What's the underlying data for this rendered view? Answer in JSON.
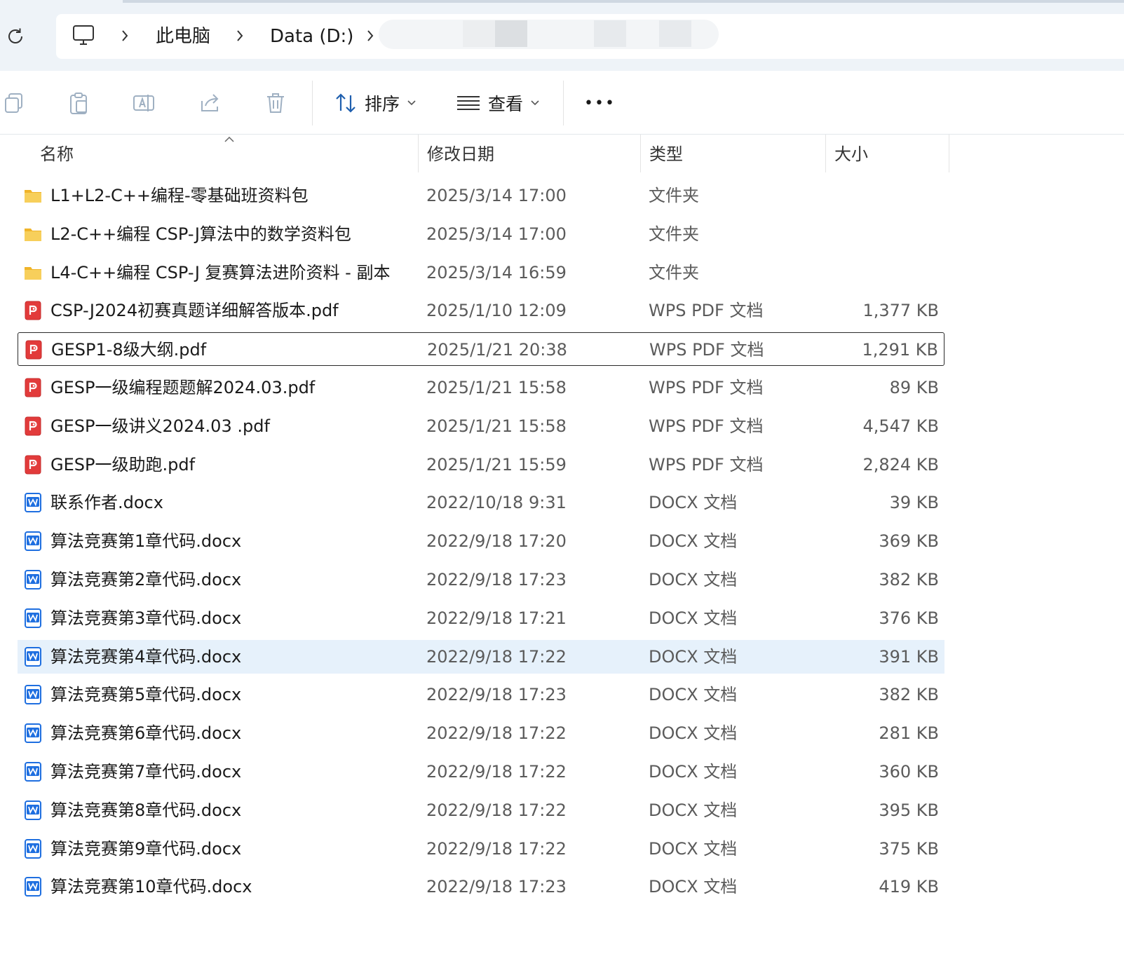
{
  "breadcrumb": {
    "items": [
      {
        "label": "此电脑"
      },
      {
        "label": "Data (D:)"
      }
    ]
  },
  "toolbar": {
    "sort_label": "排序",
    "view_label": "查看",
    "more_label": "•••"
  },
  "columns": {
    "name": "名称",
    "date": "修改日期",
    "type": "类型",
    "size": "大小"
  },
  "files": [
    {
      "icon": "folder-icon",
      "name": "L1+L2-C++编程-零基础班资料包",
      "date": "2025/3/14 17:00",
      "type": "文件夹",
      "size": ""
    },
    {
      "icon": "folder-icon",
      "name": "L2-C++编程 CSP-J算法中的数学资料包",
      "date": "2025/3/14 17:00",
      "type": "文件夹",
      "size": ""
    },
    {
      "icon": "folder-icon",
      "name": "L4-C++编程 CSP-J 复赛算法进阶资料 - 副本",
      "date": "2025/3/14 16:59",
      "type": "文件夹",
      "size": ""
    },
    {
      "icon": "pdf-icon",
      "name": "CSP-J2024初赛真题详细解答版本.pdf",
      "date": "2025/1/10 12:09",
      "type": "WPS PDF 文档",
      "size": "1,377 KB"
    },
    {
      "icon": "pdf-icon",
      "name": "GESP1-8级大纲.pdf",
      "date": "2025/1/21 20:38",
      "type": "WPS PDF 文档",
      "size": "1,291 KB",
      "state": "focused"
    },
    {
      "icon": "pdf-icon",
      "name": "GESP一级编程题题解2024.03.pdf",
      "date": "2025/1/21 15:58",
      "type": "WPS PDF 文档",
      "size": "89 KB"
    },
    {
      "icon": "pdf-icon",
      "name": "GESP一级讲义2024.03 .pdf",
      "date": "2025/1/21 15:58",
      "type": "WPS PDF 文档",
      "size": "4,547 KB"
    },
    {
      "icon": "pdf-icon",
      "name": "GESP一级助跑.pdf",
      "date": "2025/1/21 15:59",
      "type": "WPS PDF 文档",
      "size": "2,824 KB"
    },
    {
      "icon": "word-icon",
      "name": "联系作者.docx",
      "date": "2022/10/18 9:31",
      "type": "DOCX 文档",
      "size": "39 KB"
    },
    {
      "icon": "word-icon",
      "name": "算法竞赛第1章代码.docx",
      "date": "2022/9/18 17:20",
      "type": "DOCX 文档",
      "size": "369 KB"
    },
    {
      "icon": "word-icon",
      "name": "算法竞赛第2章代码.docx",
      "date": "2022/9/18 17:23",
      "type": "DOCX 文档",
      "size": "382 KB"
    },
    {
      "icon": "word-icon",
      "name": "算法竞赛第3章代码.docx",
      "date": "2022/9/18 17:21",
      "type": "DOCX 文档",
      "size": "376 KB"
    },
    {
      "icon": "word-icon",
      "name": "算法竞赛第4章代码.docx",
      "date": "2022/9/18 17:22",
      "type": "DOCX 文档",
      "size": "391 KB",
      "state": "hover"
    },
    {
      "icon": "word-icon",
      "name": "算法竞赛第5章代码.docx",
      "date": "2022/9/18 17:23",
      "type": "DOCX 文档",
      "size": "382 KB"
    },
    {
      "icon": "word-icon",
      "name": "算法竞赛第6章代码.docx",
      "date": "2022/9/18 17:22",
      "type": "DOCX 文档",
      "size": "281 KB"
    },
    {
      "icon": "word-icon",
      "name": "算法竞赛第7章代码.docx",
      "date": "2022/9/18 17:22",
      "type": "DOCX 文档",
      "size": "360 KB"
    },
    {
      "icon": "word-icon",
      "name": "算法竞赛第8章代码.docx",
      "date": "2022/9/18 17:22",
      "type": "DOCX 文档",
      "size": "395 KB"
    },
    {
      "icon": "word-icon",
      "name": "算法竞赛第9章代码.docx",
      "date": "2022/9/18 17:22",
      "type": "DOCX 文档",
      "size": "375 KB"
    },
    {
      "icon": "word-icon",
      "name": "算法竞赛第10章代码.docx",
      "date": "2022/9/18 17:23",
      "type": "DOCX 文档",
      "size": "419 KB"
    }
  ],
  "colors": {
    "accent": "#0067c0",
    "hover_row": "#e6f1fb",
    "folder": "#f3c44f",
    "pdf": "#e23b3b",
    "word": "#1f6fe0"
  }
}
